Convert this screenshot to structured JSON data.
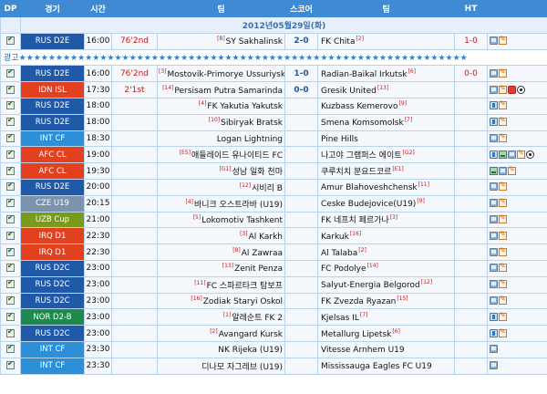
{
  "header": {
    "dp": "DP",
    "league": "경기",
    "time": "시간",
    "status": "",
    "home": "팀",
    "score": "스코어",
    "away": "팀",
    "ht": "HT"
  },
  "date_label": "2012년05월29일(화)",
  "ad_label": "광고",
  "ad_stars": "★★★★★★★★★★★★★★★★★★★★★★★★★★★★★★★★★★★★★★★★★★★★★★★★★★★★★★★★★★★★★",
  "colors": {
    "league_rus": "#1f59a8",
    "league_red": "#e3401f",
    "league_int": "#2d8fd8",
    "league_czech": "#7b93ad",
    "league_uzb": "#7a9a1a",
    "league_nor": "#1f8a4e",
    "score_blue": "#1f57a0",
    "status_red": "#c21b1b"
  },
  "matches": [
    {
      "league": "RUS D2E",
      "time": "16:00",
      "status": "76'2nd",
      "home_rank": "[8]",
      "home": "SY Sakhalinsk",
      "score": "2-0",
      "away": "FK Chita",
      "away_rank": "[2]",
      "ht": "1-0",
      "icons": [
        "tv-icon",
        "edit-icon"
      ]
    },
    {
      "league": "RUS D2E",
      "time": "16:00",
      "status": "76'2nd",
      "home_rank": "[3]",
      "home": "Mostovik-Primorye Ussuriysk",
      "score": "1-0",
      "away": "Radian-Baikal Irkutsk",
      "away_rank": "[6]",
      "ht": "0-0",
      "icons": [
        "tv-icon",
        "edit-icon"
      ]
    },
    {
      "league": "IDN ISL",
      "time": "17:30",
      "status": "2'1st",
      "home_rank": "[14]",
      "home": "Persisam Putra Samarinda",
      "score": "0-0",
      "away": "Gresik United",
      "away_rank": "[13]",
      "ht": "",
      "icons": [
        "tv-icon",
        "edit-icon",
        "red-card-icon",
        "ball-icon"
      ]
    },
    {
      "league": "RUS D2E",
      "time": "18:00",
      "status": "",
      "home_rank": "[4]",
      "home": "FK Yakutia Yakutsk",
      "score": "",
      "away": "Kuzbass Kemerovo",
      "away_rank": "[9]",
      "ht": "",
      "icons": [
        "info-icon",
        "edit-icon"
      ]
    },
    {
      "league": "RUS D2E",
      "time": "18:00",
      "status": "",
      "home_rank": "[10]",
      "home": "Sibiryak Bratsk",
      "score": "",
      "away": "Smena Komsomolsk",
      "away_rank": "[7]",
      "ht": "",
      "icons": [
        "info-icon",
        "edit-icon"
      ]
    },
    {
      "league": "INT CF",
      "time": "18:30",
      "status": "",
      "home_rank": "",
      "home": "Logan Lightning",
      "score": "",
      "away": "Pine Hills",
      "away_rank": "",
      "ht": "",
      "icons": [
        "tv-icon",
        "edit-icon"
      ]
    },
    {
      "league": "AFC CL",
      "time": "19:00",
      "status": "",
      "home_rank": "[E5]",
      "home": "애들레이드 유나이티드 FC",
      "score": "",
      "away": "나고야 그램퍼스 에이트",
      "away_rank": "[G2]",
      "ht": "",
      "icons": [
        "info-icon",
        "image-icon",
        "tv-icon",
        "edit-icon",
        "ball-icon"
      ]
    },
    {
      "league": "AFC CL",
      "time": "19:30",
      "status": "",
      "home_rank": "[G1]",
      "home": "성남 일화 천마",
      "score": "",
      "away": "쿠루치치 분요드코르",
      "away_rank": "[E1]",
      "ht": "",
      "icons": [
        "image-icon",
        "tv-icon",
        "edit-icon"
      ]
    },
    {
      "league": "RUS D2E",
      "time": "20:00",
      "status": "",
      "home_rank": "[12]",
      "home": "시비리 B",
      "score": "",
      "away": "Amur Blahoveshchensk",
      "away_rank": "[11]",
      "ht": "",
      "icons": [
        "tv-icon",
        "edit-icon"
      ]
    },
    {
      "league": "CZE U19",
      "time": "20:15",
      "status": "",
      "home_rank": "[4]",
      "home": "바니크 오스트라바 (U19)",
      "score": "",
      "away": "Ceske Budejovice(U19)",
      "away_rank": "[9]",
      "ht": "",
      "icons": [
        "tv-icon",
        "edit-icon"
      ]
    },
    {
      "league": "UZB Cup",
      "time": "21:00",
      "status": "",
      "home_rank": "[5]",
      "home": "Lokomotiv Tashkent",
      "score": "",
      "away": "FK 네프치 페르가나",
      "away_rank": "[3]",
      "ht": "",
      "icons": [
        "tv-icon",
        "edit-icon"
      ]
    },
    {
      "league": "IRQ D1",
      "time": "22:30",
      "status": "",
      "home_rank": "[3]",
      "home": "Al Karkh",
      "score": "",
      "away": "Karkuk",
      "away_rank": "[16]",
      "ht": "",
      "icons": [
        "tv-icon",
        "edit-icon"
      ]
    },
    {
      "league": "IRQ D1",
      "time": "22:30",
      "status": "",
      "home_rank": "[8]",
      "home": "Al Zawraa",
      "score": "",
      "away": "Al Talaba",
      "away_rank": "[2]",
      "ht": "",
      "icons": [
        "tv-icon",
        "edit-icon"
      ]
    },
    {
      "league": "RUS D2C",
      "time": "23:00",
      "status": "",
      "home_rank": "[13]",
      "home": "Zenit Penza",
      "score": "",
      "away": "FC Podolye",
      "away_rank": "[14]",
      "ht": "",
      "icons": [
        "tv-icon",
        "edit-icon"
      ]
    },
    {
      "league": "RUS D2C",
      "time": "23:00",
      "status": "",
      "home_rank": "[11]",
      "home": "FC 스파르타크 탐보프",
      "score": "",
      "away": "Salyut-Energia Belgorod",
      "away_rank": "[12]",
      "ht": "",
      "icons": [
        "tv-icon",
        "edit-icon"
      ]
    },
    {
      "league": "RUS D2C",
      "time": "23:00",
      "status": "",
      "home_rank": "[16]",
      "home": "Zodiak Staryi Oskol",
      "score": "",
      "away": "FK Zvezda Ryazan",
      "away_rank": "[15]",
      "ht": "",
      "icons": [
        "tv-icon",
        "edit-icon"
      ]
    },
    {
      "league": "NOR D2-B",
      "time": "23:00",
      "status": "",
      "home_rank": "[1]",
      "home": "알레순트 FK 2",
      "score": "",
      "away": "Kjelsas IL",
      "away_rank": "[7]",
      "ht": "",
      "icons": [
        "info-icon",
        "edit-icon"
      ]
    },
    {
      "league": "RUS D2C",
      "time": "23:00",
      "status": "",
      "home_rank": "[2]",
      "home": "Avangard Kursk",
      "score": "",
      "away": "Metallurg Lipetsk",
      "away_rank": "[6]",
      "ht": "",
      "icons": [
        "info-icon",
        "edit-icon"
      ]
    },
    {
      "league": "INT CF",
      "time": "23:30",
      "status": "",
      "home_rank": "",
      "home": "NK Rijeka (U19)",
      "score": "",
      "away": "Vitesse Arnhem U19",
      "away_rank": "",
      "ht": "",
      "icons": [
        "tv-icon"
      ]
    },
    {
      "league": "INT CF",
      "time": "23:30",
      "status": "",
      "home_rank": "",
      "home": "디나모 자그레브 (U19)",
      "score": "",
      "away": "Mississauga Eagles FC U19",
      "away_rank": "",
      "ht": "",
      "icons": [
        "tv-icon"
      ]
    }
  ]
}
